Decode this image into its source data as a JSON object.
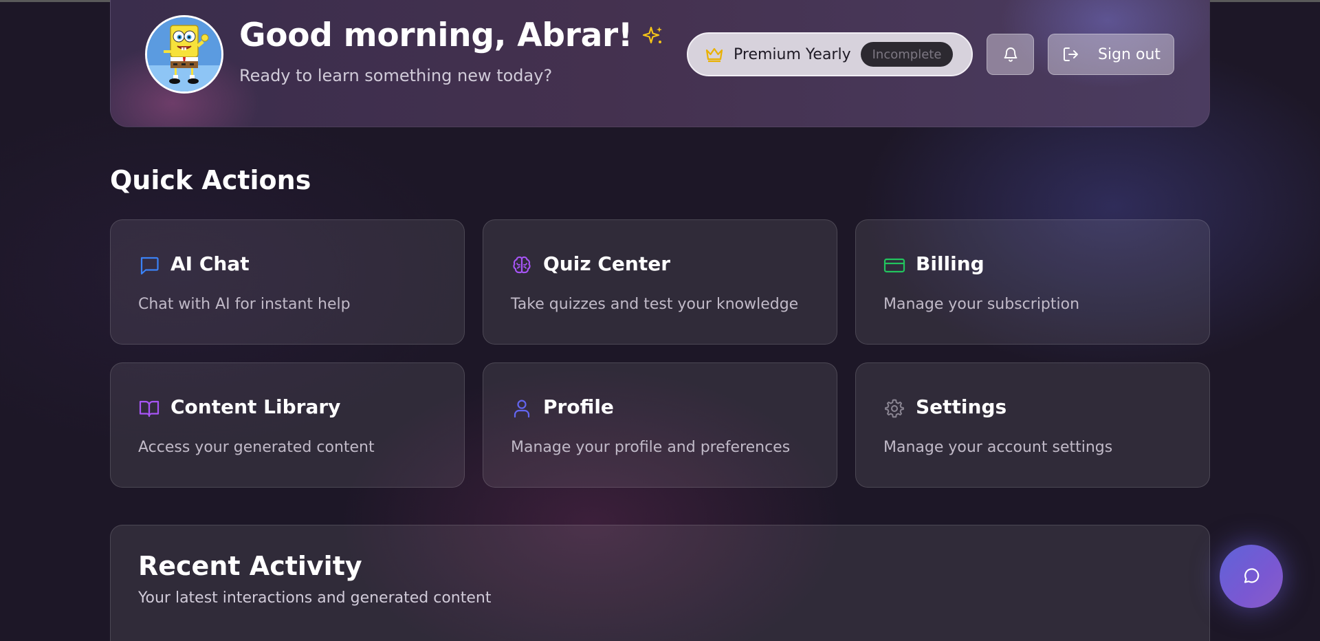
{
  "header": {
    "greeting": "Good morning, Abrar!",
    "subtitle": "Ready to learn something new today?",
    "plan_name": "Premium Yearly",
    "plan_status": "Incomplete",
    "sign_out_label": "Sign out",
    "avatar_alt": "SpongeBob avatar"
  },
  "quick_actions": {
    "title": "Quick Actions",
    "cards": [
      {
        "title": "AI Chat",
        "description": "Chat with AI for instant help",
        "icon": "message-square-icon",
        "icon_color": "#3b82f6"
      },
      {
        "title": "Quiz Center",
        "description": "Take quizzes and test your knowledge",
        "icon": "brain-icon",
        "icon_color": "#a855f7"
      },
      {
        "title": "Billing",
        "description": "Manage your subscription",
        "icon": "credit-card-icon",
        "icon_color": "#22c55e"
      },
      {
        "title": "Content Library",
        "description": "Access your generated content",
        "icon": "book-open-icon",
        "icon_color": "#a855f7"
      },
      {
        "title": "Profile",
        "description": "Manage your profile and preferences",
        "icon": "user-icon",
        "icon_color": "#6366f1"
      },
      {
        "title": "Settings",
        "description": "Manage your account settings",
        "icon": "gear-icon",
        "icon_color": "#8b8693"
      }
    ]
  },
  "recent_activity": {
    "title": "Recent Activity",
    "subtitle": "Your latest interactions and generated content"
  },
  "colors": {
    "background": "#1d1727",
    "accent_gold": "#f5c518",
    "fab_gradient_start": "#5f63d8",
    "fab_gradient_end": "#8a5cc8"
  }
}
